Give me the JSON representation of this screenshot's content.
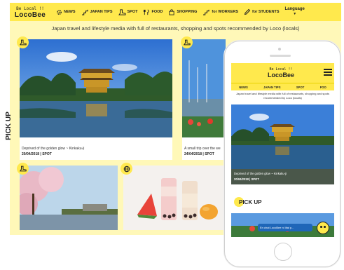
{
  "nav": {
    "logo_top": "Be Local !!",
    "logo_main": "LocoBee",
    "items": [
      {
        "label": "NEWS",
        "icon": "gear-icon"
      },
      {
        "label": "JAPAN TIPS",
        "icon": "stairs-icon"
      },
      {
        "label": "SPOT",
        "icon": "boot-icon"
      },
      {
        "label": "FOOD",
        "icon": "fork-knife-icon"
      },
      {
        "label": "SHOPPING",
        "icon": "shopping-bag-icon"
      },
      {
        "label": "for WORKERS",
        "icon": "stairs-icon"
      },
      {
        "label": "for STUDENTS",
        "icon": "pencil-icon"
      }
    ],
    "language": "Language"
  },
  "tagline": "Japan travel and lifestyle media with full of restaurants, shopping and spots recommended by Loco (locals)",
  "pickup_label": "PICK UP",
  "cards": [
    {
      "caption": "Deprived of the golden glow ~ Kinkaku-ji",
      "date": "20/04/2018 | SPOT"
    },
    {
      "caption": "A small trip over the we",
      "date": "24/04/2018 | SPOT"
    }
  ],
  "phone": {
    "logo_top": "Be Local !!",
    "logo_main": "LocoBee",
    "nav": [
      "NEWS",
      "JAPAN TIPS",
      "SPOT",
      "FOO"
    ],
    "tagline": "Japan travel and lifestyle media with full of restaurants, shopping and spots recommended by Loco (locals)",
    "caption": "Deprived of the golden glow ~ Kinkaku-ji",
    "date": "20/04/2018 | SPOT",
    "pickup_label": "PICK UP",
    "chat_bubble": "En chat LocoBee ni iitai p..."
  },
  "colors": {
    "brand_yellow": "#ffe94d",
    "page_bg": "#fff8b8"
  }
}
